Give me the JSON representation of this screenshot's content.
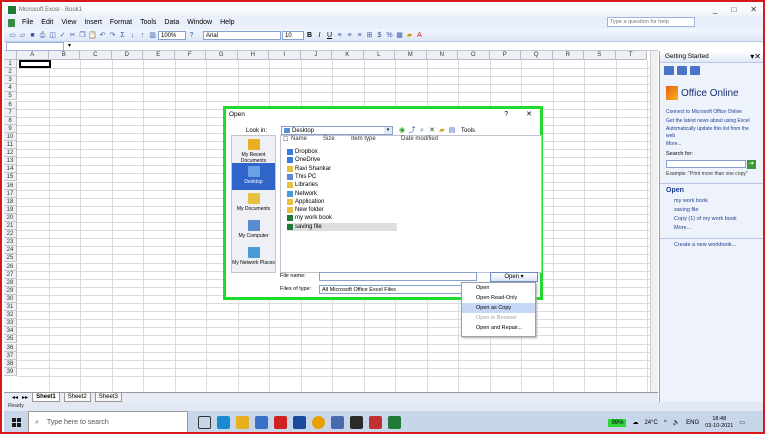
{
  "window": {
    "title": "Microsoft Excel - Book1",
    "min": "_",
    "max": "□",
    "close": "✕"
  },
  "menu": [
    "File",
    "Edit",
    "View",
    "Insert",
    "Format",
    "Tools",
    "Data",
    "Window",
    "Help"
  ],
  "ask_placeholder": "Type a question for help",
  "toolbar": {
    "zoom": "100%",
    "font": "Arial",
    "size": "10"
  },
  "columns": [
    "A",
    "B",
    "C",
    "D",
    "E",
    "F",
    "G",
    "H",
    "I",
    "J",
    "K",
    "L",
    "M",
    "N",
    "O",
    "P",
    "Q",
    "R",
    "S",
    "T"
  ],
  "rows": [
    "1",
    "2",
    "3",
    "4",
    "5",
    "6",
    "7",
    "8",
    "9",
    "10",
    "11",
    "12",
    "13",
    "14",
    "15",
    "16",
    "17",
    "18",
    "19",
    "20",
    "21",
    "22",
    "23",
    "24",
    "25",
    "26",
    "27",
    "28",
    "29",
    "30",
    "31",
    "32",
    "33",
    "34",
    "35",
    "36",
    "37",
    "38",
    "39"
  ],
  "sheets": [
    "Sheet1",
    "Sheet2",
    "Sheet3"
  ],
  "status": "Ready",
  "taskpane": {
    "title": "Getting Started",
    "office_online": "Office Online",
    "links": [
      "Connect to Microsoft Office Online",
      "Get the latest news about using Excel",
      "Automatically update this list from the web"
    ],
    "more": "More...",
    "search_label": "Search for:",
    "example": "Example: \"Print more than one copy\"",
    "open_title": "Open",
    "recent": [
      "my work book",
      "saving file",
      "Copy (1) of my work book",
      "More..."
    ],
    "create": "Create a new workbook..."
  },
  "dialog": {
    "title": "Open",
    "help": "?",
    "close": "✕",
    "look_in_label": "Look in:",
    "look_in_value": "Desktop",
    "tools_label": "Tools",
    "columns": [
      "Name",
      "Size",
      "Item type",
      "Date modified"
    ],
    "places": [
      "My Recent Documents",
      "Desktop",
      "My Documents",
      "My Computer",
      "My Network Places"
    ],
    "files": [
      "Dropbox",
      "OneDrive",
      "Ravi Shankar",
      "This PC",
      "Libraries",
      "Network",
      "Application",
      "New folder",
      "my work book",
      "saving file"
    ],
    "file_name_label": "File name:",
    "file_type_label": "Files of type:",
    "file_type_value": "All Microsoft Office Excel Files",
    "open_button": "Open"
  },
  "open_menu": [
    "Open",
    "Open Read-Only",
    "Open as Copy",
    "Open in Browser",
    "Open and Repair..."
  ],
  "taskbar": {
    "search_placeholder": "Type here to search",
    "battery": "99%",
    "temp": "24°C",
    "lang": "ENG",
    "time": "18:48",
    "date": "03-10-2021"
  }
}
